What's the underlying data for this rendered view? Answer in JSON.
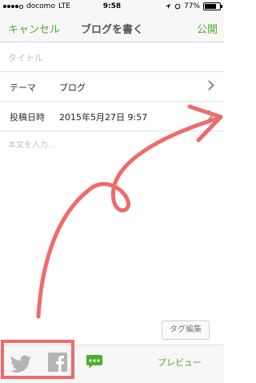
{
  "status_bar": {
    "carrier": "docomo",
    "network": "LTE",
    "time": "9:58",
    "battery": "77%",
    "battery_level": 0.77
  },
  "navbar": {
    "cancel_label": "キャンセル",
    "title": "ブログを書く",
    "publish_label": "公開"
  },
  "form": {
    "title_placeholder": "タイトル",
    "theme_label": "テーマ",
    "theme_value": "ブログ",
    "date_label": "投稿日時",
    "date_value": "2015年5月27日 9:57",
    "body_placeholder": "本文を入力..."
  },
  "tag_button_label": "タグ編集",
  "toolbar": {
    "preview_label": "プレビュー"
  },
  "colors": {
    "accent_green": "#4caf2a",
    "annotation_red": "#f06a6a"
  },
  "icons": [
    "twitter-icon",
    "facebook-icon",
    "comment-icon",
    "chevron-right-icon"
  ]
}
